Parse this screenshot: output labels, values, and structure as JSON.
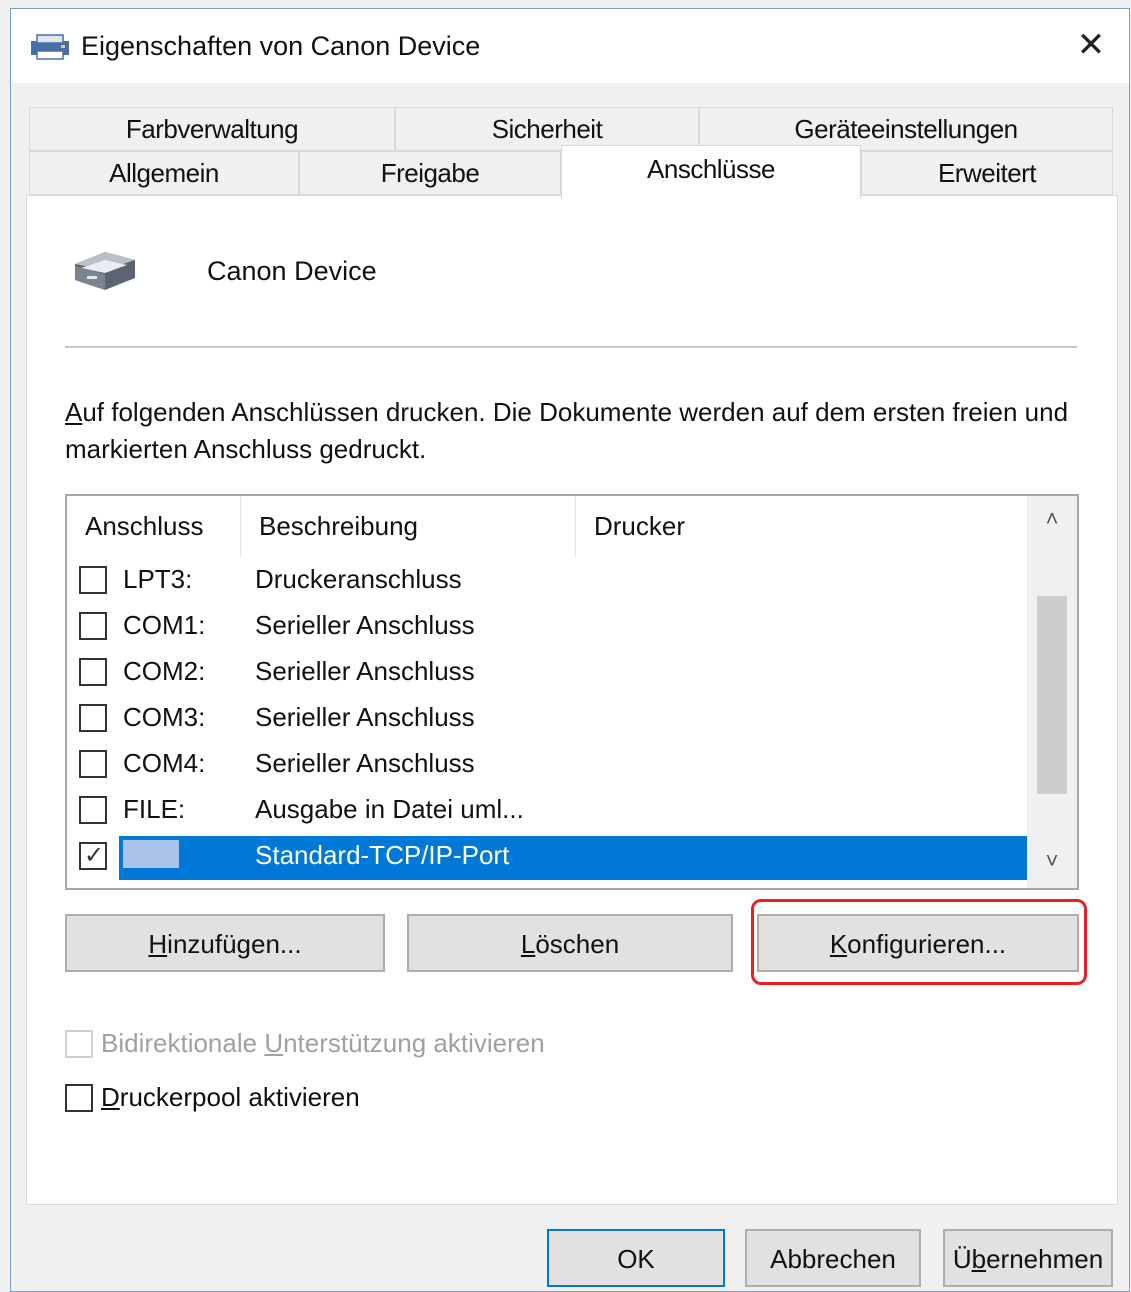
{
  "window": {
    "title": "Eigenschaften von Canon Device",
    "close_glyph": "✕"
  },
  "tabs_back": [
    "Farbverwaltung",
    "Sicherheit",
    "Geräteeinstellungen"
  ],
  "tabs_front": [
    "Allgemein",
    "Freigabe",
    "Anschlüsse",
    "Erweitert"
  ],
  "active_tab": "Anschlüsse",
  "device": {
    "name": "Canon Device",
    "icon": "printer-icon"
  },
  "description": {
    "first_letter": "A",
    "rest": "uf folgenden Anschlüssen drucken. Die Dokumente werden auf dem ersten freien und markierten Anschluss gedruckt."
  },
  "ports_table": {
    "headers": [
      "Anschluss",
      "Beschreibung",
      "Drucker"
    ],
    "rows": [
      {
        "port": "LPT3:",
        "description": "Druckeranschluss",
        "checked": false
      },
      {
        "port": "COM1:",
        "description": "Serieller Anschluss",
        "checked": false
      },
      {
        "port": "COM2:",
        "description": "Serieller Anschluss",
        "checked": false
      },
      {
        "port": "COM3:",
        "description": "Serieller Anschluss",
        "checked": false
      },
      {
        "port": "COM4:",
        "description": "Serieller Anschluss",
        "checked": false
      },
      {
        "port": "FILE:",
        "description": "Ausgabe in Datei uml...",
        "checked": false
      },
      {
        "port": "",
        "description": "Standard-TCP/IP-Port",
        "checked": true,
        "selected": true
      }
    ],
    "scroll_up_glyph": "˄",
    "scroll_down_glyph": "˅"
  },
  "port_buttons": {
    "add": {
      "mnemonic": "H",
      "rest": "inzufügen..."
    },
    "delete": {
      "mnemonic": "L",
      "rest": "öschen"
    },
    "configure": {
      "mnemonic": "K",
      "rest": "onfigurieren..."
    }
  },
  "options": {
    "bidi": {
      "before": "Bidirektionale ",
      "mnemonic": "U",
      "after": "nterstützung aktivieren",
      "checked": false,
      "disabled": true
    },
    "pool": {
      "mnemonic": "D",
      "after": "ruckerpool aktivieren",
      "checked": false
    }
  },
  "footer": {
    "ok": "OK",
    "cancel": "Abbrechen",
    "apply_before": "Ü",
    "apply_mnemonic": "b",
    "apply_after": "ernehmen"
  },
  "colors": {
    "selection": "#0078d7",
    "highlight_frame": "#e32424",
    "default_button_border": "#0078d7"
  }
}
